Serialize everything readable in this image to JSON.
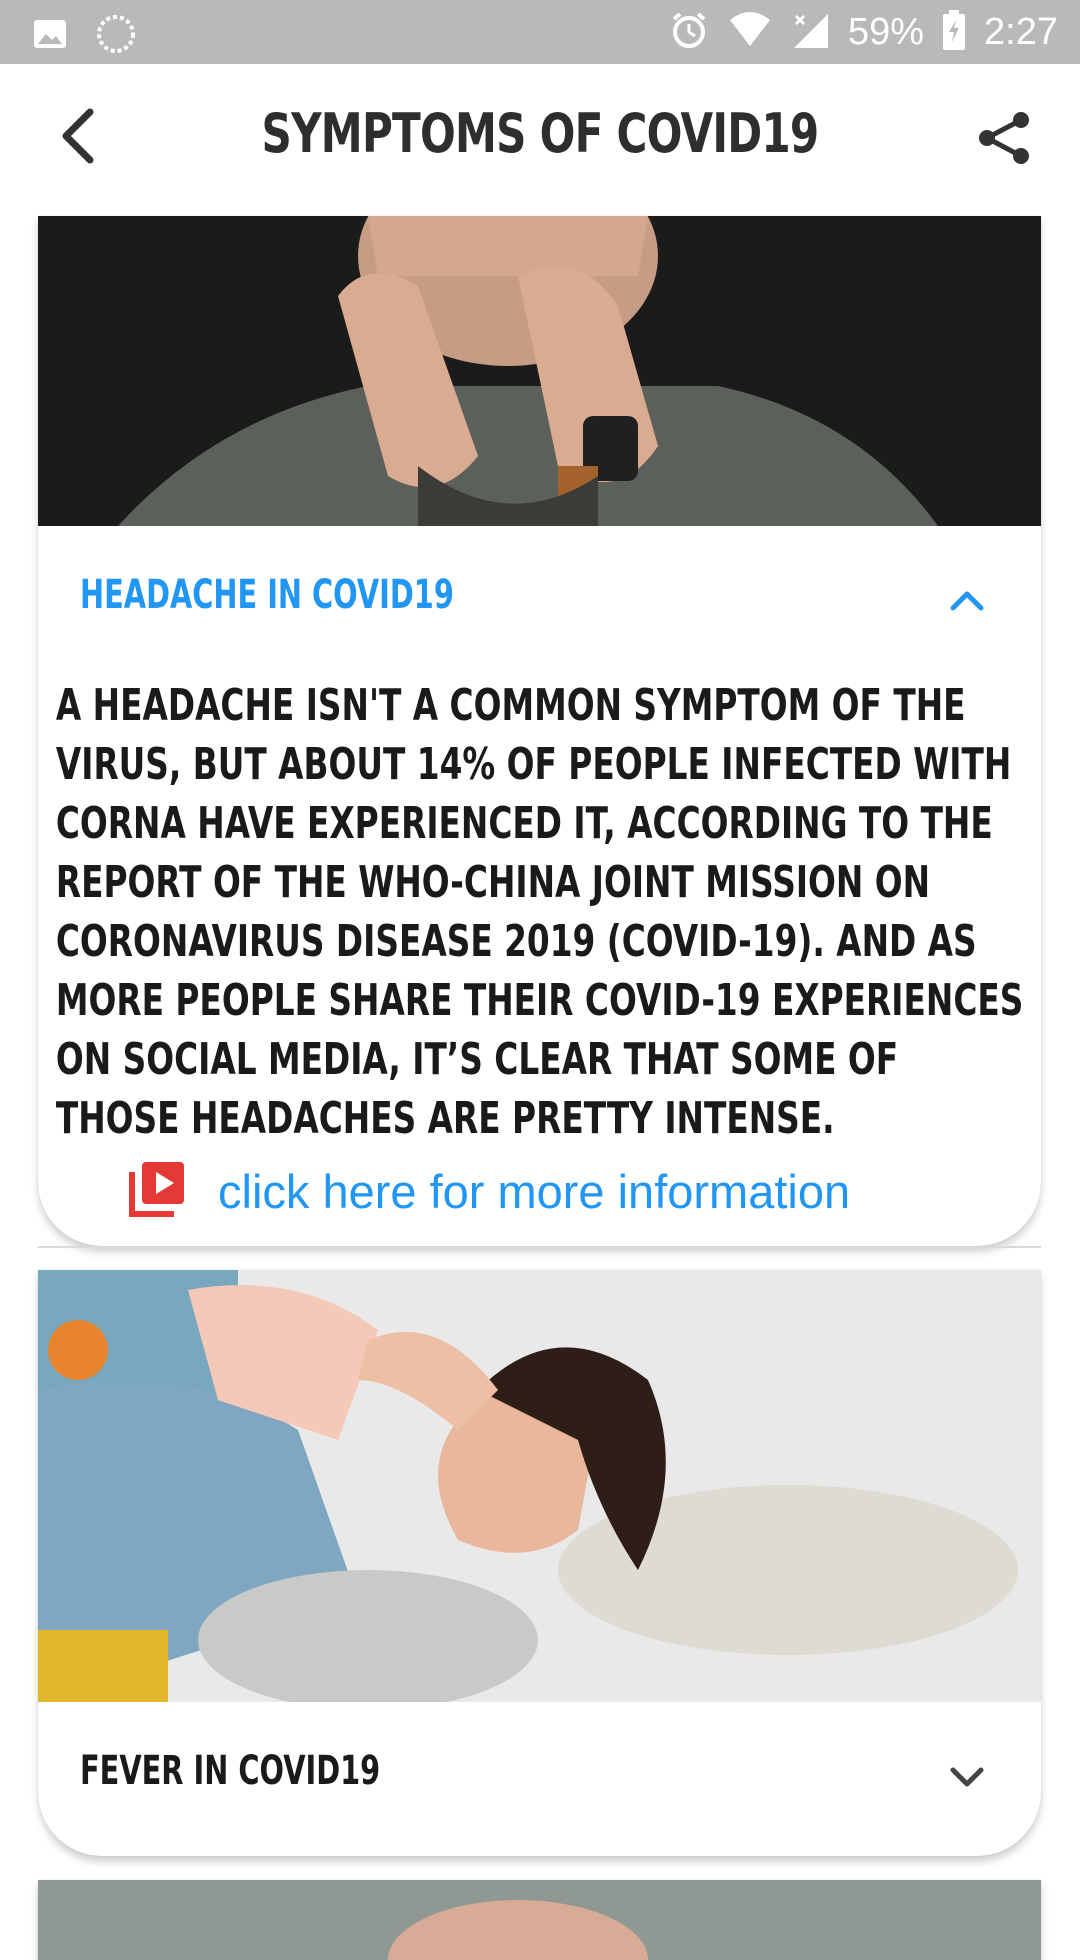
{
  "status_bar": {
    "battery": "59%",
    "time": "2:27"
  },
  "app_bar": {
    "title": "SYMPTOMS OF COVID19"
  },
  "cards": [
    {
      "title": "HEADACHE IN COVID19",
      "expanded": true,
      "title_color": "#2196f3",
      "body": "A headache isn't a common symptom of the virus, but about 14% of people infected with corna have experienced it, according to the report of the WHO-China Joint Mission on Coronavirus Disease 2019 (COVID-19). And as more people share their COVID-19 experiences on social media, it’s clear that some of those headaches are pretty intense.",
      "link_text": "click here for more information",
      "link_icon": "video-library-icon"
    },
    {
      "title": "FEVER IN COVID19",
      "expanded": false,
      "title_color": "#1a1a1a"
    }
  ],
  "colors": {
    "accent": "#2196f3",
    "link_icon": "#e53935",
    "status_bar": "#b9b9b9"
  }
}
